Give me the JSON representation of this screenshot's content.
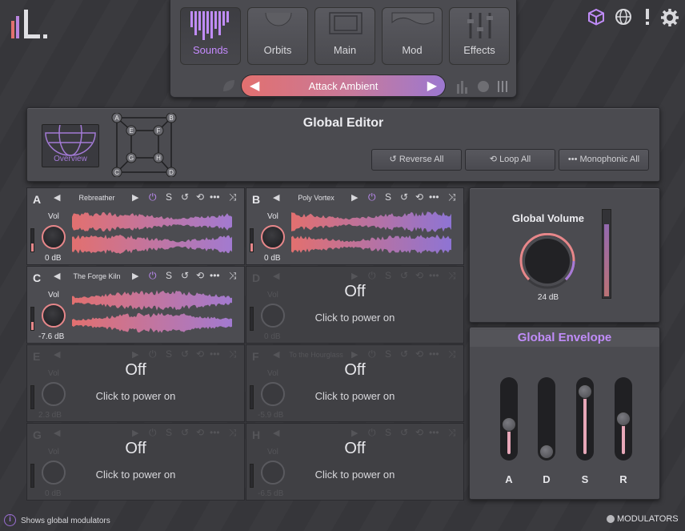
{
  "nav": {
    "tabs": [
      {
        "label": "Sounds",
        "active": true
      },
      {
        "label": "Orbits",
        "active": false
      },
      {
        "label": "Main",
        "active": false
      },
      {
        "label": "Mod",
        "active": false
      },
      {
        "label": "Effects",
        "active": false
      }
    ],
    "preset": "Attack Ambient"
  },
  "top_icons": [
    "cube-icon",
    "globe-icon",
    "alert-icon",
    "gear-icon"
  ],
  "global_editor": {
    "title": "Global Editor",
    "overview_label": "Overview",
    "matrix_nodes": [
      "A",
      "B",
      "C",
      "D",
      "E",
      "F",
      "G",
      "H"
    ],
    "buttons": {
      "reverse": "Reverse All",
      "loop": "Loop All",
      "mono": "Monophonic All"
    }
  },
  "slots": [
    {
      "letter": "A",
      "name": "Rebreather",
      "vol_label": "Vol",
      "db": "0 dB",
      "on": true
    },
    {
      "letter": "B",
      "name": "Poly Vortex",
      "vol_label": "Vol",
      "db": "0 dB",
      "on": true
    },
    {
      "letter": "C",
      "name": "The Forge Kiln",
      "vol_label": "Vol",
      "db": "-7.6 dB",
      "on": true
    },
    {
      "letter": "D",
      "name": "",
      "vol_label": "Vol",
      "db": "0 dB",
      "on": false,
      "off_text": "Off",
      "power_text": "Click to power on"
    },
    {
      "letter": "E",
      "name": "",
      "vol_label": "Vol",
      "db": "2.3 dB",
      "on": false,
      "off_text": "Off",
      "power_text": "Click to power on"
    },
    {
      "letter": "F",
      "name": "To the Hourglass",
      "vol_label": "Vol",
      "db": "-5.9 dB",
      "on": false,
      "off_text": "Off",
      "power_text": "Click to power on"
    },
    {
      "letter": "G",
      "name": "",
      "vol_label": "Vol",
      "db": "0 dB",
      "on": false,
      "off_text": "Off",
      "power_text": "Click to power on"
    },
    {
      "letter": "H",
      "name": "",
      "vol_label": "Vol",
      "db": "-6.5 dB",
      "on": false,
      "off_text": "Off",
      "power_text": "Click to power on"
    }
  ],
  "global_volume": {
    "title": "Global Volume",
    "value": "24 dB"
  },
  "global_envelope": {
    "title": "Global Envelope",
    "faders": [
      {
        "label": "A",
        "level": 0.42
      },
      {
        "label": "D",
        "level": 0.0
      },
      {
        "label": "S",
        "level": 0.92
      },
      {
        "label": "R",
        "level": 0.5
      }
    ]
  },
  "footer": {
    "hint": "Shows global modulators",
    "modulators": "MODULATORS"
  },
  "colors": {
    "accent_purple": "#c08cf8",
    "wave_start": "#e2706f",
    "wave_end": "#9c78d0"
  }
}
